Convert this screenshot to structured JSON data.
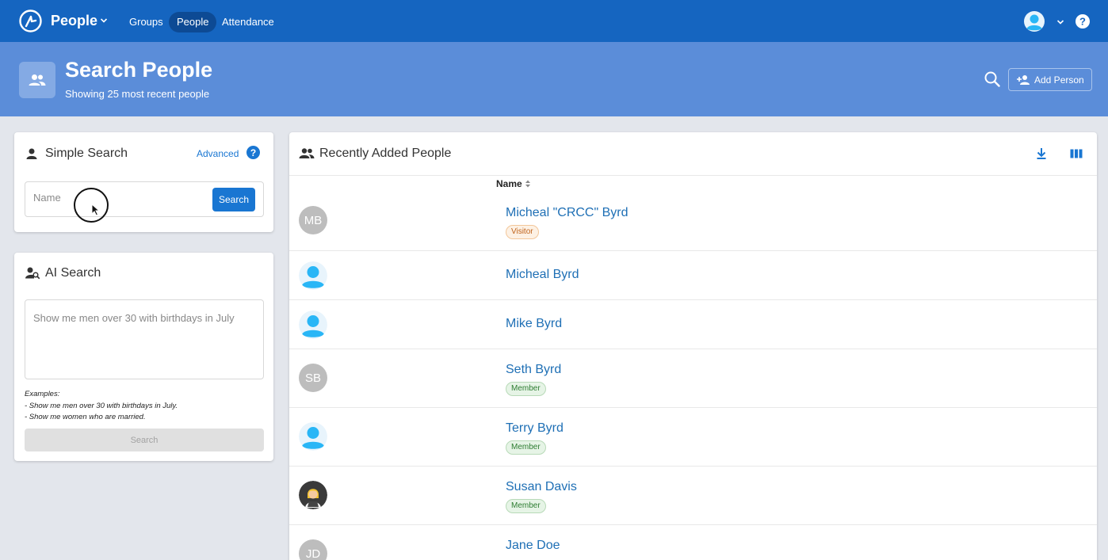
{
  "topbar": {
    "app_title": "People",
    "nav": [
      {
        "label": "Groups"
      },
      {
        "label": "People"
      },
      {
        "label": "Attendance"
      }
    ]
  },
  "banner": {
    "title": "Search People",
    "subtitle": "Showing 25 most recent people",
    "add_person_label": "Add Person"
  },
  "simple_search": {
    "title": "Simple Search",
    "advanced_label": "Advanced",
    "name_placeholder": "Name",
    "name_value": "",
    "search_label": "Search"
  },
  "ai_search": {
    "title": "AI Search",
    "placeholder": "Show me men over 30 with birthdays in July",
    "examples_heading": "Examples:",
    "example_1": "- Show me men over 30 with birthdays in July.",
    "example_2": "- Show me women who are married.",
    "search_label": "Search"
  },
  "people_list": {
    "title": "Recently Added People",
    "column_name": "Name",
    "rows": [
      {
        "initials": "MB",
        "name": "Micheal \"CRCC\" Byrd",
        "badge": "Visitor",
        "avatar": "initials"
      },
      {
        "initials": "",
        "name": "Micheal Byrd",
        "badge": "",
        "avatar": "default"
      },
      {
        "initials": "",
        "name": "Mike Byrd",
        "badge": "",
        "avatar": "default"
      },
      {
        "initials": "SB",
        "name": "Seth Byrd",
        "badge": "Member",
        "avatar": "initials"
      },
      {
        "initials": "",
        "name": "Terry Byrd",
        "badge": "Member",
        "avatar": "default"
      },
      {
        "initials": "",
        "name": "Susan Davis",
        "badge": "Member",
        "avatar": "photo"
      },
      {
        "initials": "JD",
        "name": "Jane Doe",
        "badge": "",
        "avatar": "initials"
      }
    ]
  },
  "colors": {
    "topbar": "#1565c0",
    "banner": "#5b8dd9",
    "accent": "#1976d2",
    "link": "#1e6fb5"
  },
  "icons": {
    "logo": "logo-icon",
    "user": "user-avatar-icon",
    "help": "help-icon",
    "search": "search-icon",
    "add_person": "person-add-icon",
    "download": "download-icon",
    "columns": "columns-icon",
    "sort": "sort-icon"
  }
}
